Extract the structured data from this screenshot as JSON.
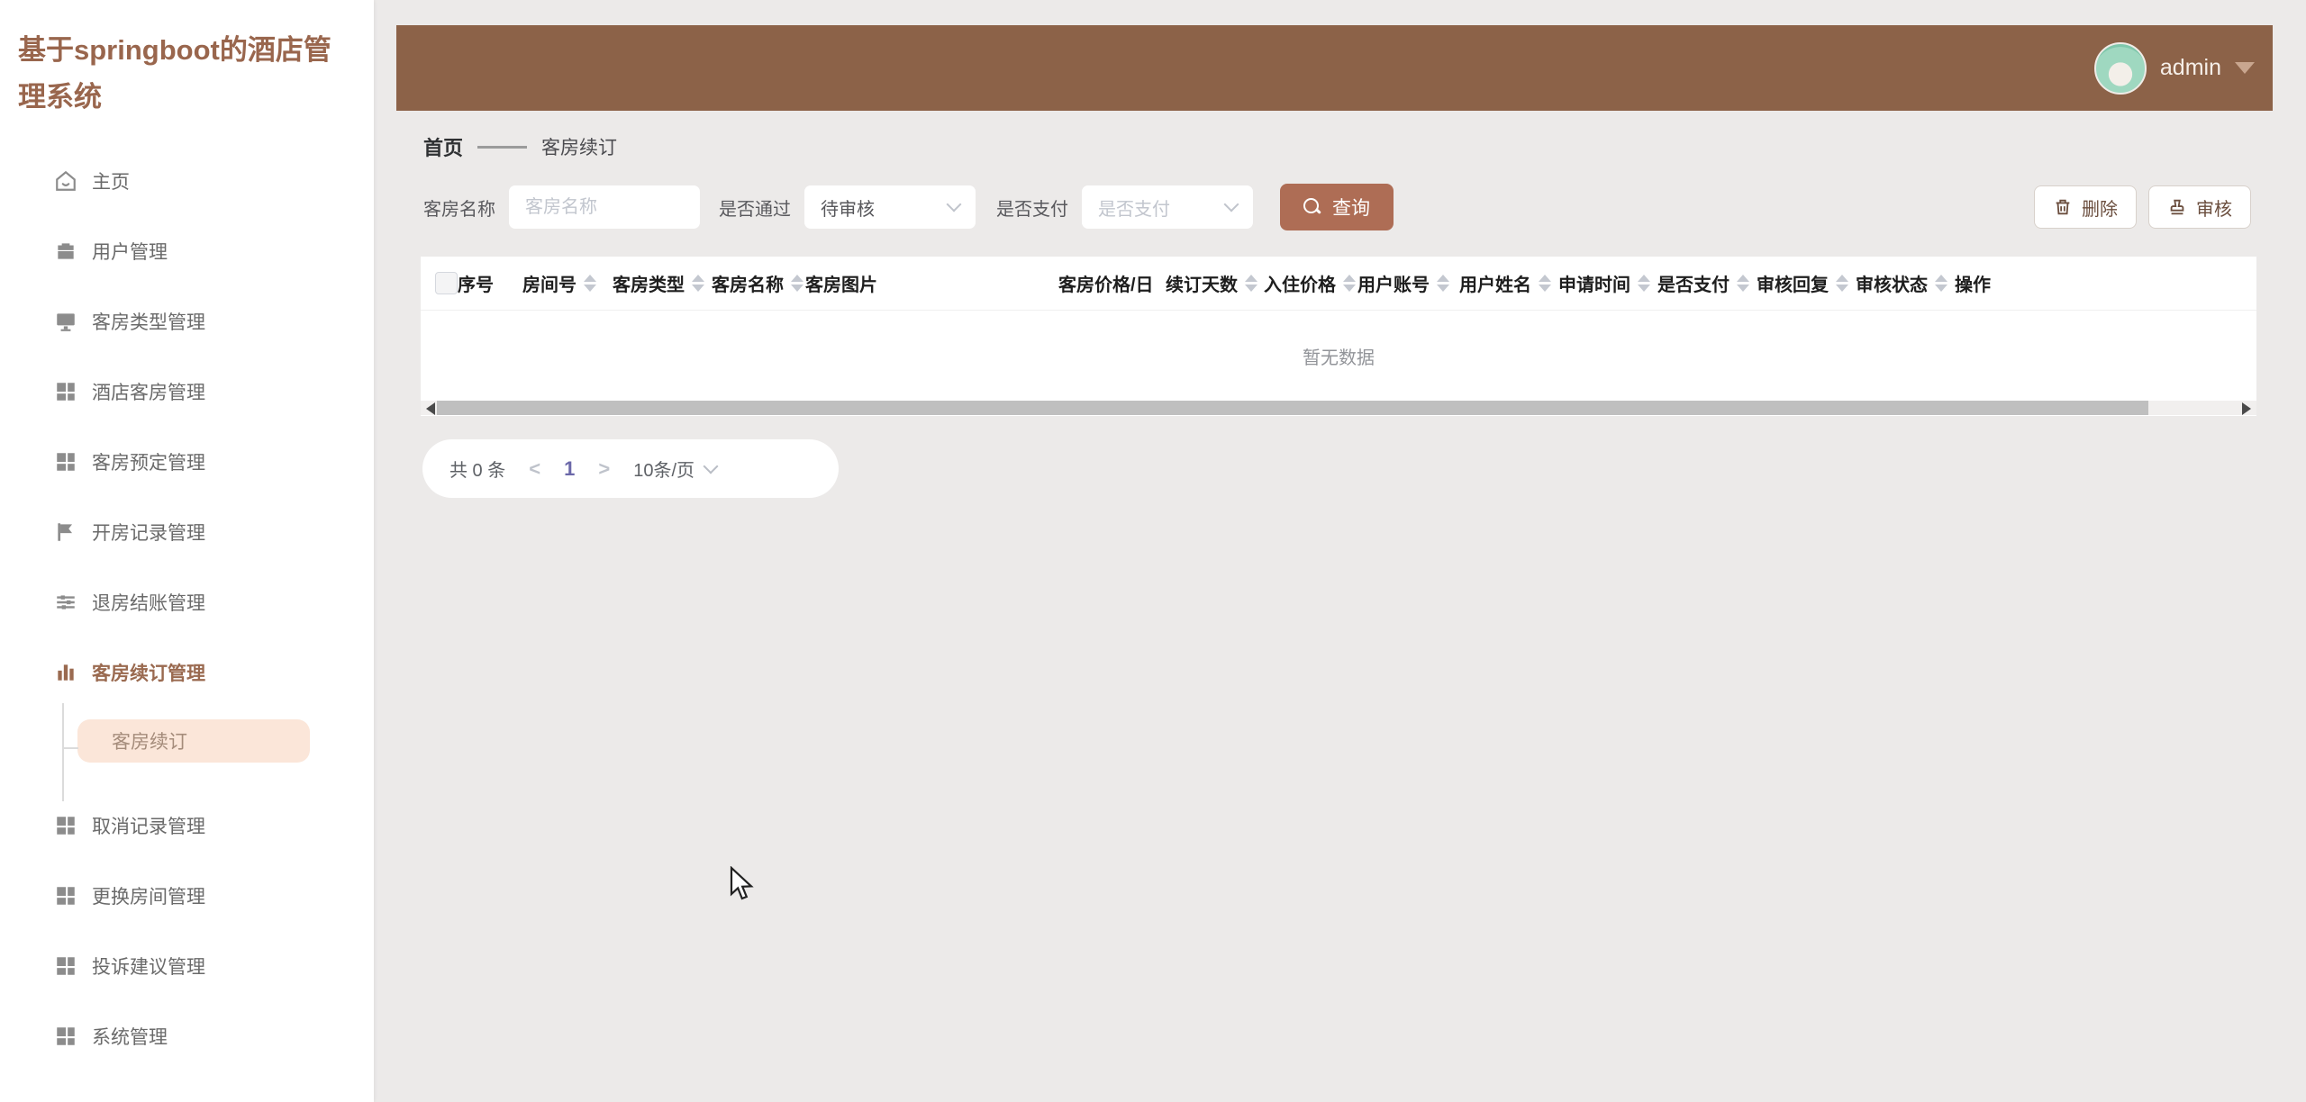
{
  "app": {
    "title": "基于springboot的酒店管理系统"
  },
  "header": {
    "username": "admin"
  },
  "sidebar": {
    "items": [
      {
        "label": "主页",
        "icon": "home-icon",
        "active": false
      },
      {
        "label": "用户管理",
        "icon": "briefcase-icon",
        "active": false
      },
      {
        "label": "客房类型管理",
        "icon": "monitor-icon",
        "active": false
      },
      {
        "label": "酒店客房管理",
        "icon": "grid-icon",
        "active": false
      },
      {
        "label": "客房预定管理",
        "icon": "grid-icon",
        "active": false
      },
      {
        "label": "开房记录管理",
        "icon": "flag-icon",
        "active": false
      },
      {
        "label": "退房结账管理",
        "icon": "sliders-icon",
        "active": false
      },
      {
        "label": "客房续订管理",
        "icon": "bar-chart-icon",
        "active": true
      },
      {
        "label": "取消记录管理",
        "icon": "grid-icon",
        "active": false
      },
      {
        "label": "更换房间管理",
        "icon": "grid-icon",
        "active": false
      },
      {
        "label": "投诉建议管理",
        "icon": "grid-icon",
        "active": false
      },
      {
        "label": "系统管理",
        "icon": "grid-icon",
        "active": false
      }
    ],
    "submenu": {
      "parent": "客房续订管理",
      "label": "客房续订",
      "active": true
    }
  },
  "breadcrumb": {
    "home": "首页",
    "current": "客房续订"
  },
  "filters": {
    "room_name_label": "客房名称",
    "room_name_placeholder": "客房名称",
    "room_name_value": "",
    "pass_label": "是否通过",
    "pass_value": "待审核",
    "pay_label": "是否支付",
    "pay_placeholder": "是否支付",
    "search_label": "查询"
  },
  "actions": {
    "delete_label": "删除",
    "audit_label": "审核"
  },
  "table": {
    "columns": [
      {
        "label": "序号",
        "sortable": false
      },
      {
        "label": "房间号",
        "sortable": true
      },
      {
        "label": "客房类型",
        "sortable": true
      },
      {
        "label": "客房名称",
        "sortable": true
      },
      {
        "label": "客房图片",
        "sortable": false
      },
      {
        "label": "客房价格/日",
        "sortable": false
      },
      {
        "label": "续订天数",
        "sortable": true
      },
      {
        "label": "入住价格",
        "sortable": true
      },
      {
        "label": "用户账号",
        "sortable": true
      },
      {
        "label": "用户姓名",
        "sortable": true
      },
      {
        "label": "申请时间",
        "sortable": true
      },
      {
        "label": "是否支付",
        "sortable": true
      },
      {
        "label": "审核回复",
        "sortable": true
      },
      {
        "label": "审核状态",
        "sortable": true
      },
      {
        "label": "操作",
        "sortable": false
      }
    ],
    "rows": [],
    "empty_text": "暂无数据"
  },
  "pagination": {
    "total": "共 0 条",
    "prev": "<",
    "current_page": "1",
    "next": ">",
    "page_size": "10条/页"
  },
  "colors": {
    "header_bar": "#8C6248",
    "accent_button": "#AE6D55",
    "sidebar_active": "#9A6A50",
    "submenu_bg": "#FBE6D9",
    "page_bg": "#ECEAE9",
    "pager_current": "#6B68A9"
  }
}
